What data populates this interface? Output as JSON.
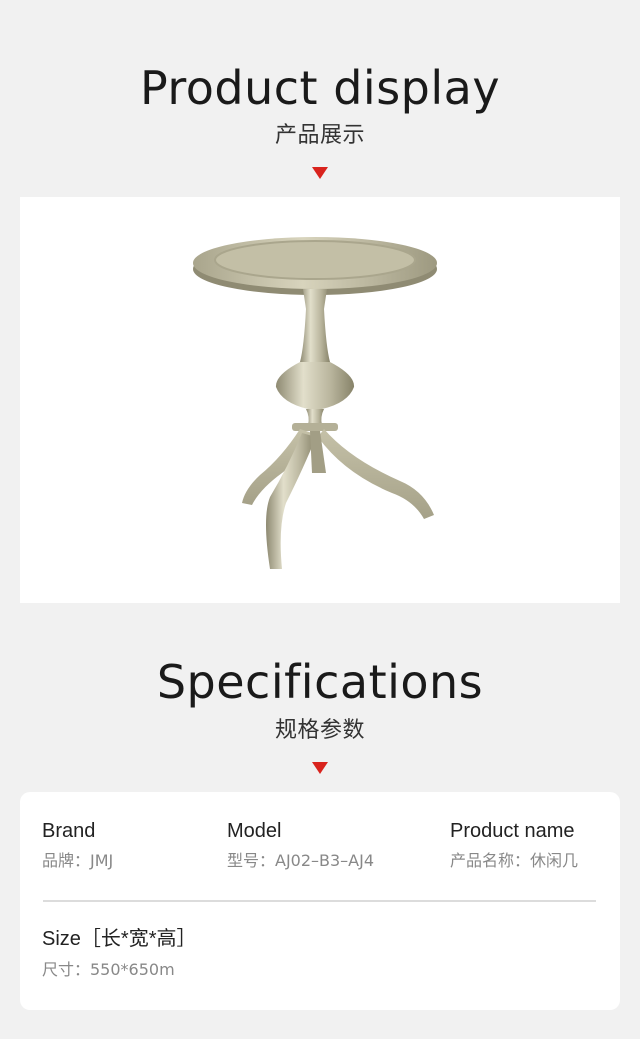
{
  "product_display": {
    "title_en": "Product display",
    "title_cn": "产品展示",
    "image_alt": ""
  },
  "specifications": {
    "title_en": "Specifications",
    "title_cn": "规格参数",
    "brand_label": "Brand",
    "brand_value": "品牌：JMJ",
    "model_label": "Model",
    "model_value": "型号：AJ02–B3–AJ4",
    "product_name_label": "Product name",
    "product_name_value": "产品名称：休闲几",
    "size_label": "Size［长*宽*高］",
    "size_value": "尺寸：550*650m"
  },
  "colors": {
    "accent": "#d9231d",
    "background": "#f1f1f1",
    "card": "#ffffff",
    "table_finish": "#c9c5ac"
  },
  "icons": {
    "pointer": "down-triangle-icon"
  }
}
